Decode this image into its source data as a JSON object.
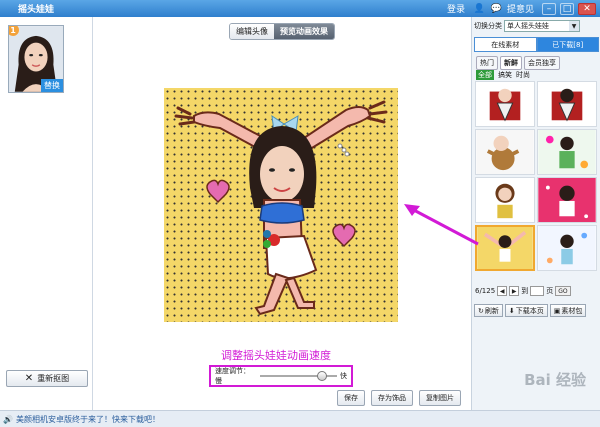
{
  "titlebar": {
    "title": "摇头娃娃",
    "login": "登录",
    "feedback": "提意见",
    "badge_count": "1"
  },
  "left": {
    "swap_label": "替换",
    "recrop_label": "重新抠图"
  },
  "main": {
    "tabs": [
      {
        "label": "编辑头像",
        "active": false
      },
      {
        "label": "预览动画效果",
        "active": true
      }
    ],
    "annotation": "调整摇头娃娃动画速度",
    "speed_label": "速度调节：慢",
    "speed_fast": "快",
    "speed_value_percent": 80,
    "buttons": {
      "save": "保存",
      "save_as_material": "存为饰品",
      "copy_image": "复制图片"
    }
  },
  "right": {
    "category_label": "切换分类",
    "category_value": "单人摇头娃娃",
    "tabs": [
      {
        "label": "在线素材",
        "active": true
      },
      {
        "label": "已下载[8]",
        "active": false
      }
    ],
    "subtabs": [
      {
        "label": "热门",
        "active": false
      },
      {
        "label": "新鲜",
        "active": true
      },
      {
        "label": "会员独享",
        "active": false
      }
    ],
    "filters": [
      {
        "label": "全部",
        "active": true
      },
      {
        "label": "搞笑",
        "active": false
      },
      {
        "label": "时尚",
        "active": false
      }
    ],
    "pager": {
      "page": "6/125",
      "to_label": "到",
      "page_label": "页",
      "go": "GO"
    },
    "buttons": {
      "refresh": "刷新",
      "download_page": "下载本页",
      "material_pack": "素材包"
    }
  },
  "status": {
    "message": "美颜相机安卓版终于来了！快来下载吧！"
  },
  "watermark": "Bai 经验",
  "colors": {
    "accent": "#2e86de",
    "annotation": "#d21ad6",
    "canvas_bg": "#f4d768"
  }
}
